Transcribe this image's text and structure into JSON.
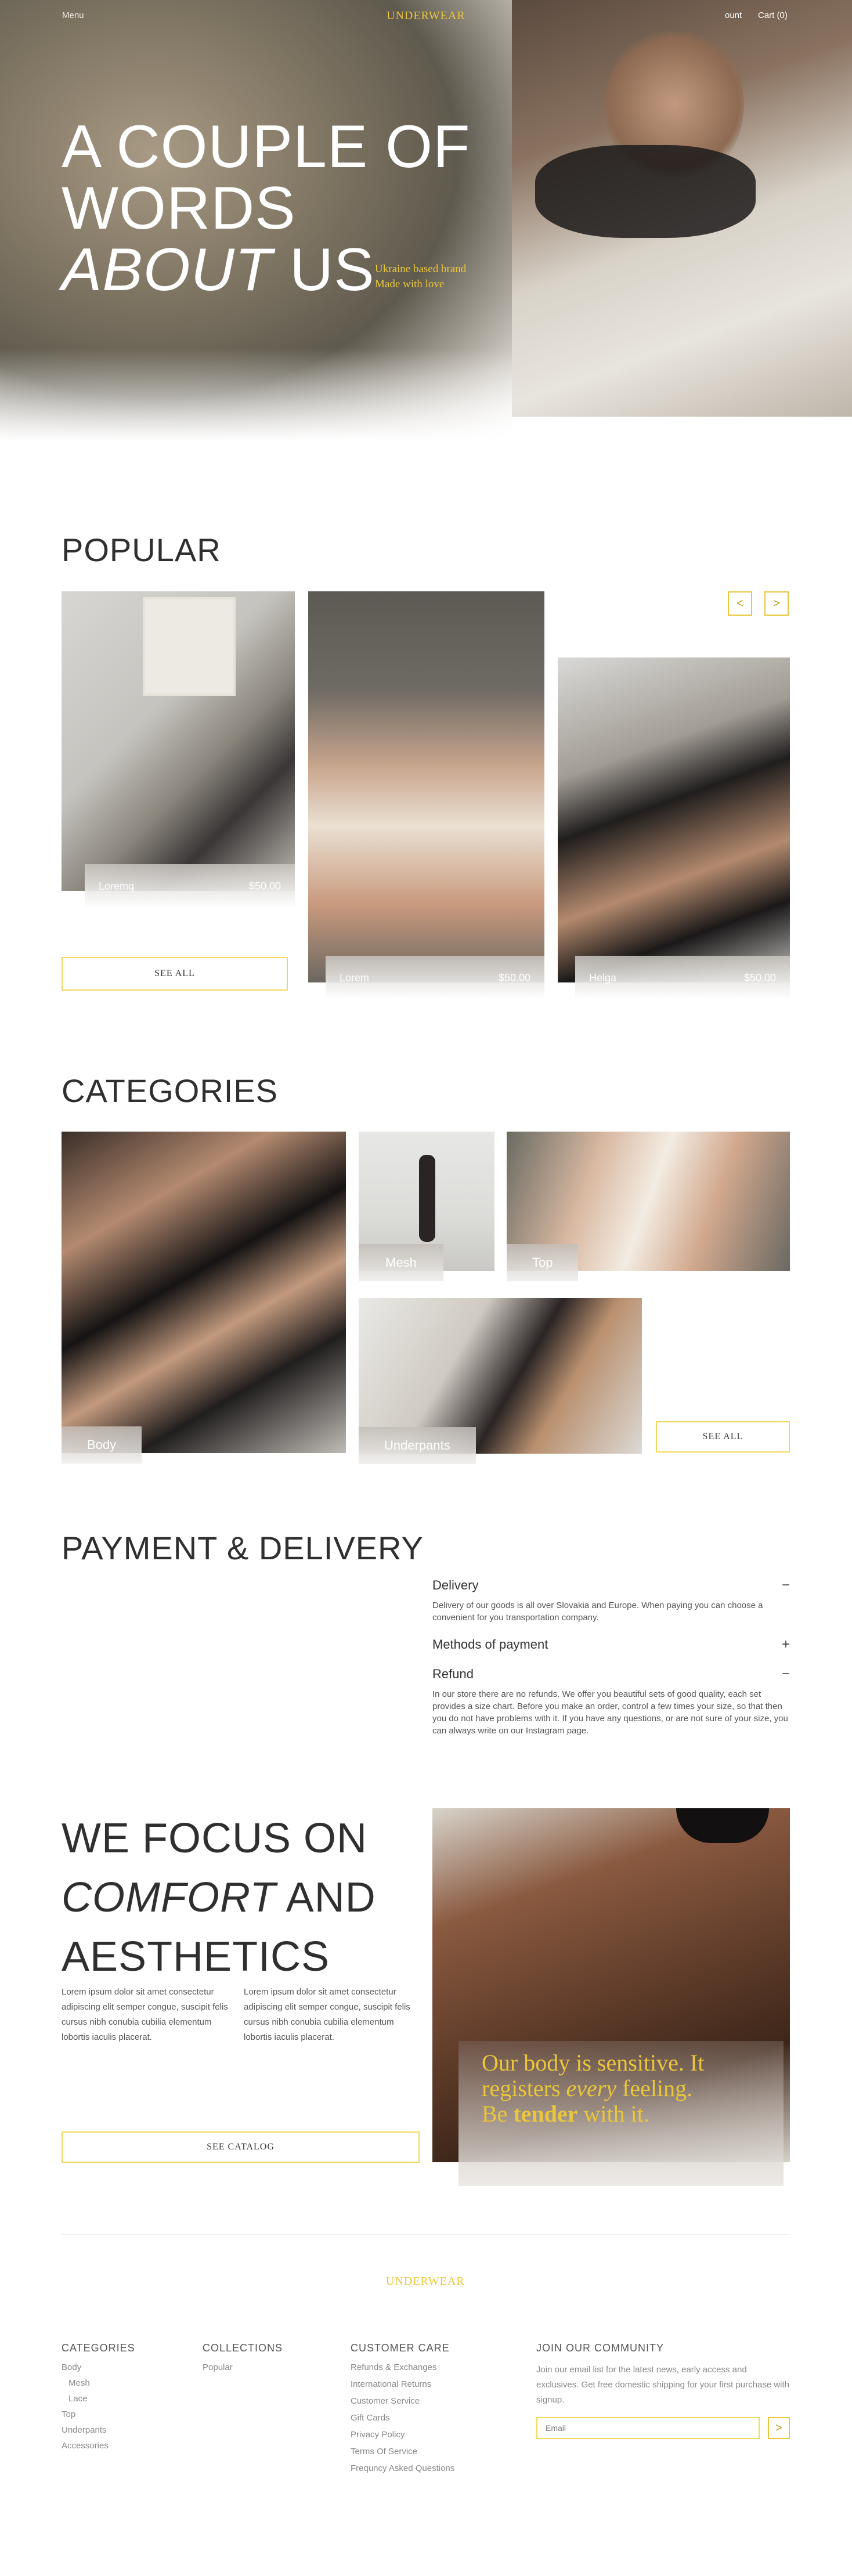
{
  "header": {
    "menu_label": "Menu",
    "logo": "UNDERWEAR",
    "account_label": "ount",
    "cart_label": "Cart (0)"
  },
  "hero": {
    "line1": "A COUPLE OF",
    "line2": "WORDS",
    "line3_italic": "ABOUT",
    "line3_rest": " US",
    "tagline1": "Ukraine based brand",
    "tagline2": "Made with love"
  },
  "popular": {
    "title": "POPULAR",
    "prev_label": "<",
    "next_label": ">",
    "see_all": "SEE ALL",
    "products": [
      {
        "name": "Loremq",
        "price": "$50.00"
      },
      {
        "name": "Lorem",
        "price": "$50.00"
      },
      {
        "name": "Helga",
        "price": "$50.00"
      }
    ]
  },
  "categories": {
    "title": "CATEGORIES",
    "see_all": "SEE ALL",
    "items": [
      "Body",
      "Mesh",
      "Top",
      "Underpants"
    ]
  },
  "payment": {
    "title": "PAYMENT & DELIVERY",
    "faq": [
      {
        "title": "Delivery",
        "sign": "−",
        "text": "Delivery of our goods is all over Slovakia and Europe. When paying you can choose a convenient for you transportation company."
      },
      {
        "title": "Methods of payment",
        "sign": "+",
        "text": ""
      },
      {
        "title": "Refund",
        "sign": "−",
        "text": "In our store there are no refunds. We offer you beautiful sets of good quality, each set provides a size chart. Before you make an order, control a few times your size, so that then you do not have problems with it. If you have any questions, or are not sure of your size, you can always write on our Instagram page."
      }
    ]
  },
  "focus": {
    "line1": "WE FOCUS ON",
    "line2_italic": "COMFORT",
    "line2_rest": " AND",
    "line3": "AESTHETICS",
    "para1": "Lorem ipsum dolor sit amet consectetur adipiscing elit semper congue, suscipit felis cursus nibh conubia cubilia elementum lobortis iaculis placerat.",
    "para2": "Lorem ipsum dolor sit amet consectetur adipiscing elit semper congue, suscipit felis cursus nibh conubia cubilia elementum lobortis iaculis placerat.",
    "catalog_button": "SEE CATALOG",
    "quote_line1": "Our body is sensitive. It",
    "quote_line2_a": "registers ",
    "quote_line2_italic": "every",
    "quote_line2_b": " feeling.",
    "quote_line3_a": "Be ",
    "quote_line3_bold": "tender",
    "quote_line3_b": " with it."
  },
  "footer": {
    "logo": "UNDERWEAR",
    "categories_title": "CATEGORIES",
    "categories": [
      "Body",
      "Mesh",
      "Lace",
      "Top",
      "Underpants",
      "Accessories"
    ],
    "collections_title": "COLLECTIONS",
    "collections": [
      "Popular"
    ],
    "care_title": "CUSTOMER CARE",
    "care": [
      "Refunds & Exchanges",
      "International Returns",
      "Customer Service",
      "Gift Cards",
      "Privacy Policy",
      "Terms Of Service",
      "Frequncy Asked Questions"
    ],
    "community_title": "JOIN OUR COMMUNITY",
    "community_text": "Join our email list for the latest news, early access and exclusives. Get free domestic shipping for your first purchase with signup.",
    "email_placeholder": "Email",
    "submit_label": ">"
  },
  "colors": {
    "accent": "#e9c63a",
    "text": "#2f2f2f",
    "muted": "#888888"
  }
}
